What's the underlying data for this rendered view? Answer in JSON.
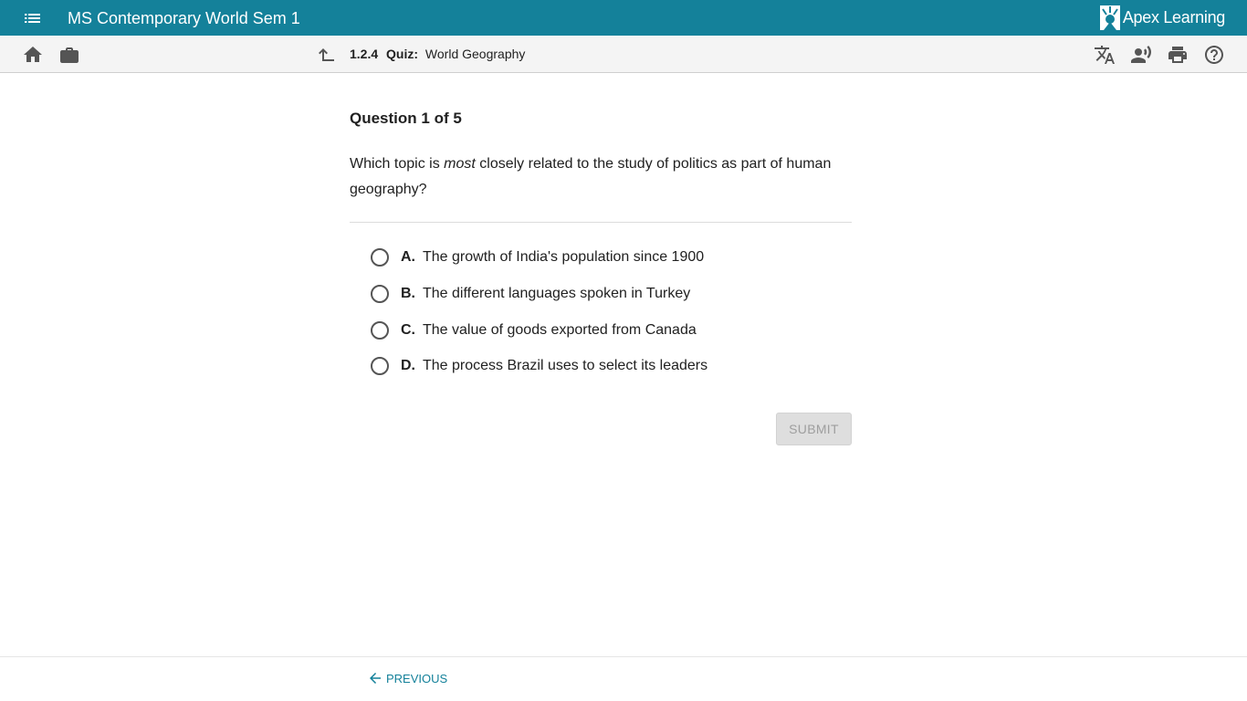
{
  "header": {
    "course_title": "MS Contemporary World Sem 1",
    "brand": "Apex Learning",
    "menu_icon": "menu-icon",
    "accent_color": "#14819a"
  },
  "toolbar": {
    "home_icon": "home-icon",
    "briefcase_icon": "briefcase-icon",
    "up_icon": "level-up-icon",
    "breadcrumb": {
      "number": "1.2.4",
      "type": "Quiz:",
      "title": "World Geography"
    },
    "right_icons": [
      "translate-icon",
      "read-aloud-icon",
      "print-icon",
      "help-icon"
    ]
  },
  "question": {
    "heading": "Question 1 of 5",
    "text_before": "Which topic is ",
    "text_emphasis": "most",
    "text_after": " closely related to the study of politics as part of human geography?",
    "choices": [
      {
        "letter": "A.",
        "text": "The growth of India's population since 1900"
      },
      {
        "letter": "B.",
        "text": "The different languages spoken in Turkey"
      },
      {
        "letter": "C.",
        "text": "The value of goods exported from Canada"
      },
      {
        "letter": "D.",
        "text": "The process Brazil uses to select its leaders"
      }
    ],
    "submit_label": "SUBMIT"
  },
  "footer": {
    "previous_label": "PREVIOUS"
  }
}
